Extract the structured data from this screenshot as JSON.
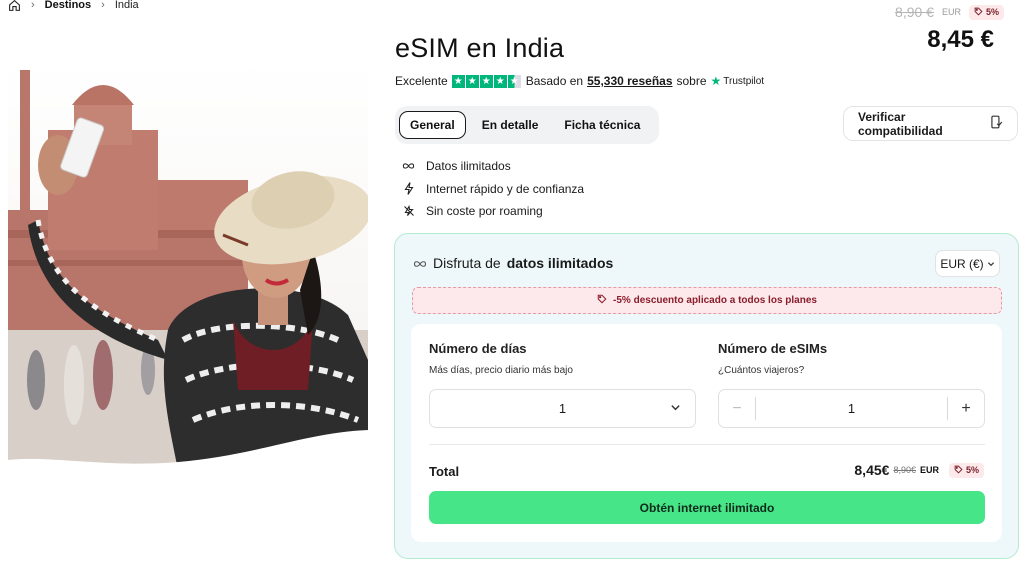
{
  "breadcrumb": {
    "items": [
      "Destinos",
      "India"
    ]
  },
  "product": {
    "title": "eSIM en India"
  },
  "rating": {
    "label": "Excelente",
    "stars": 4.5,
    "based_prefix": "Basado en",
    "reviews": "55,330 reseñas",
    "on": "sobre",
    "source": "Trustpilot"
  },
  "price": {
    "old": "8,90 €",
    "currency_code": "EUR",
    "discount_badge": "5%",
    "current": "8,45 €"
  },
  "tabs": [
    {
      "label": "General",
      "active": true
    },
    {
      "label": "En detalle",
      "active": false
    },
    {
      "label": "Ficha técnica",
      "active": false
    }
  ],
  "verify_button": {
    "label": "Verificar compatibilidad"
  },
  "features": [
    {
      "icon": "infinity-icon",
      "label": "Datos ilimitados"
    },
    {
      "icon": "bolt-icon",
      "label": "Internet rápido y de confianza"
    },
    {
      "icon": "no-roaming-icon",
      "label": "Sin coste por roaming"
    }
  ],
  "plan": {
    "heading_prefix": "Disfruta de",
    "heading_strong": "datos ilimitados",
    "currency_select": "EUR (€)",
    "discount_notice": "-5% descuento aplicado a todos los planes",
    "days": {
      "title": "Número de días",
      "subtitle": "Más días, precio diario más bajo",
      "value": "1"
    },
    "esims": {
      "title": "Número de eSIMs",
      "subtitle": "¿Cuántos viajeros?",
      "value": "1",
      "minus": "−",
      "plus": "+"
    },
    "total": {
      "label": "Total",
      "current": "8,45€",
      "old": "8,90€",
      "currency": "EUR",
      "badge": "5%"
    },
    "cta": "Obtén internet ilimitado"
  },
  "colors": {
    "accent_green": "#45e588",
    "trustpilot_green": "#00b67a",
    "discount_bg": "#fde9eb",
    "discount_text": "#8a1d2b",
    "plan_bg": "#eef8fa",
    "plan_border": "#b4eacd"
  }
}
